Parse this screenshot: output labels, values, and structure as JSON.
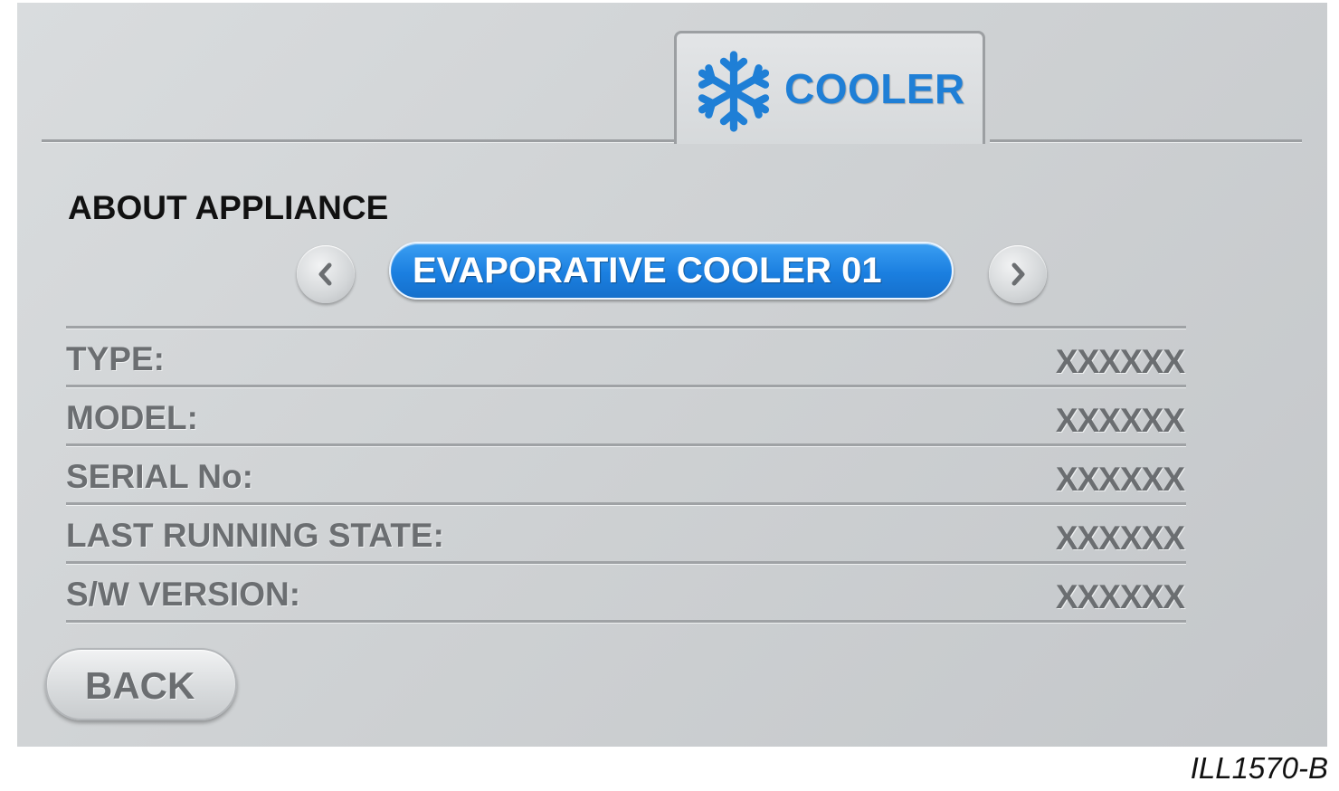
{
  "header": {
    "tab_label": "COOLER",
    "tab_icon": "snowflake-icon",
    "accent_color": "#1f7fd6"
  },
  "section": {
    "title": "ABOUT APPLIANCE"
  },
  "appliance_selector": {
    "prev_icon": "chevron-left-icon",
    "next_icon": "chevron-right-icon",
    "selected": "EVAPORATIVE COOLER 01",
    "pill_color": "#1b7fe0"
  },
  "info": {
    "rows": [
      {
        "label": "TYPE:",
        "value": "XXXXXX"
      },
      {
        "label": "MODEL:",
        "value": "XXXXXX"
      },
      {
        "label": "SERIAL No:",
        "value": "XXXXXX"
      },
      {
        "label": "LAST RUNNING STATE:",
        "value": "XXXXXX"
      },
      {
        "label": "S/W VERSION:",
        "value": "XXXXXX"
      }
    ]
  },
  "footer": {
    "back_label": "BACK"
  },
  "caption": "ILL1570-B"
}
